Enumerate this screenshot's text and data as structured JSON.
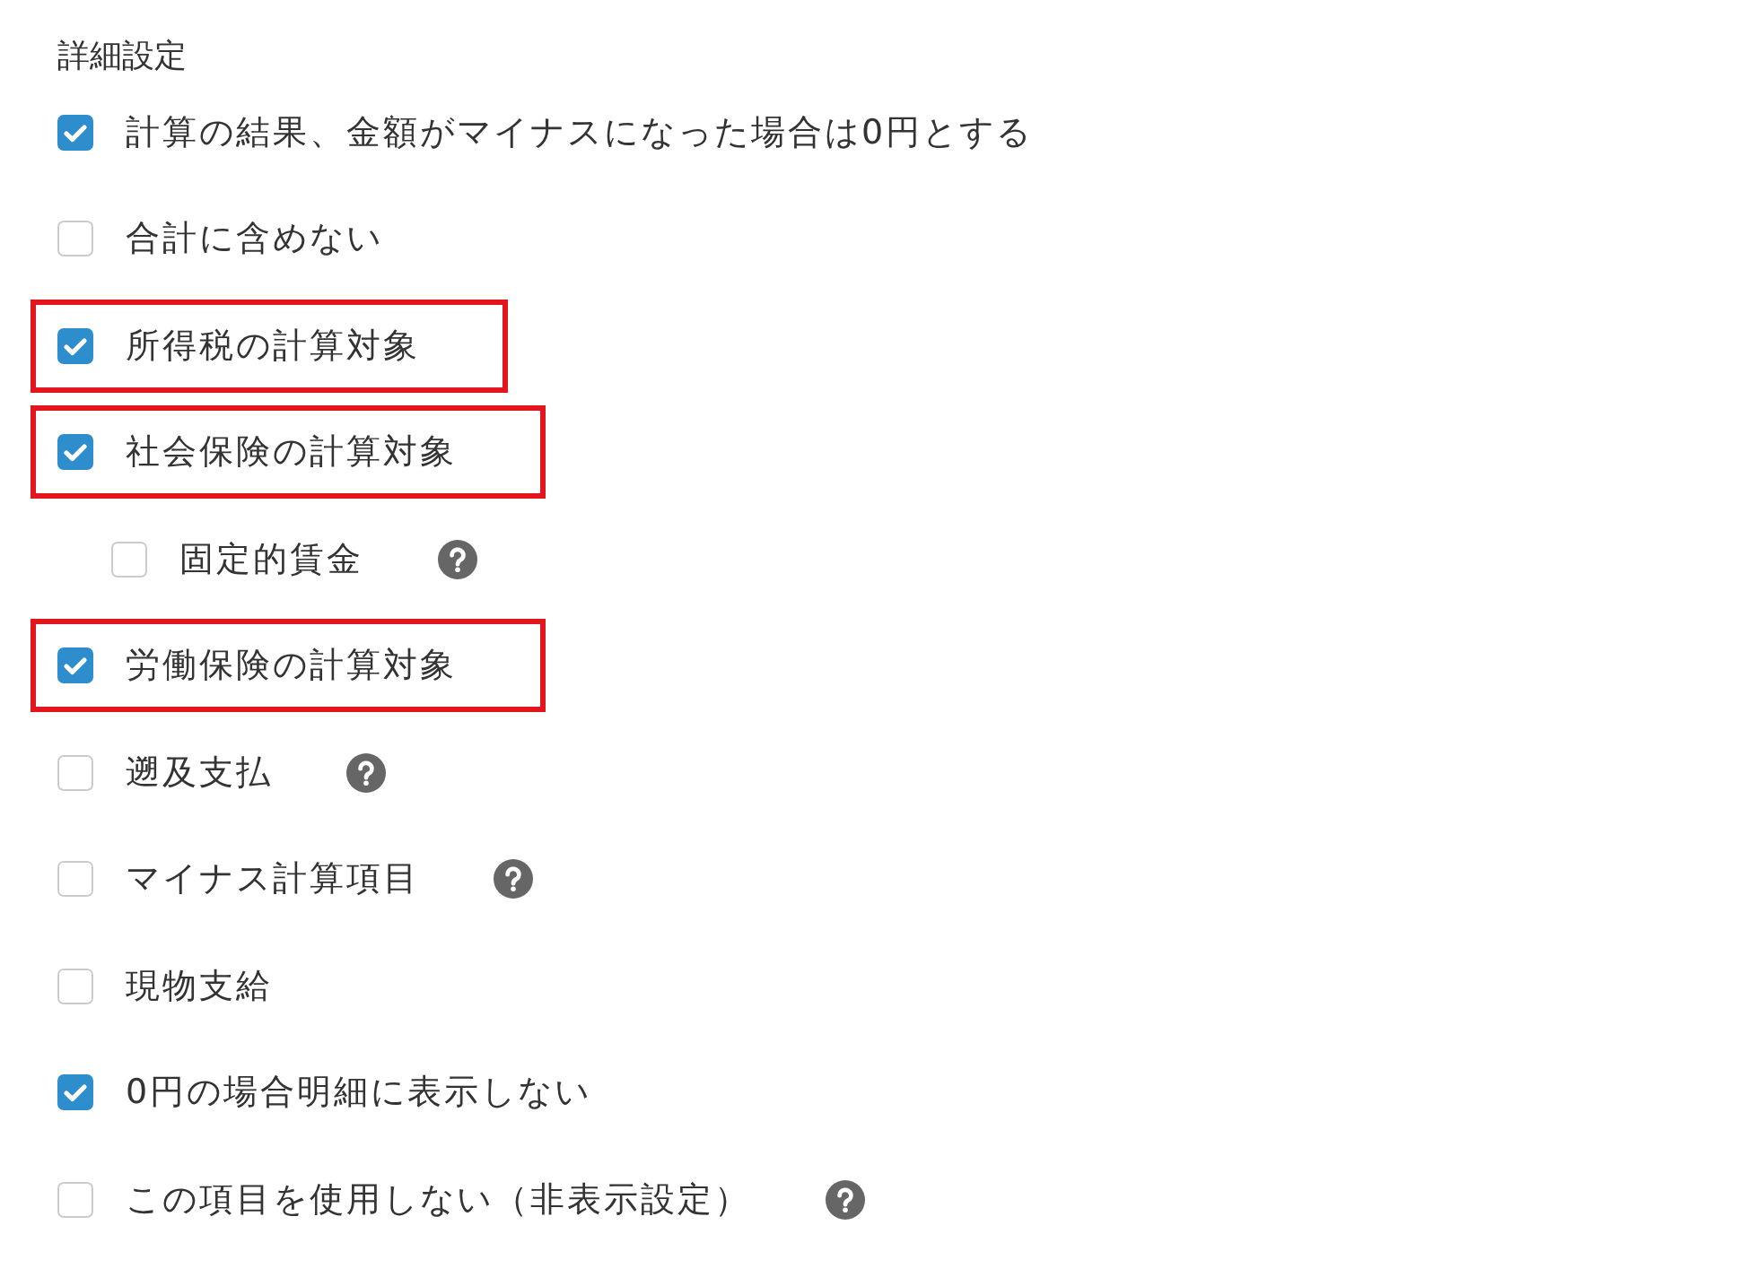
{
  "section_title": "詳細設定",
  "options": [
    {
      "label": "計算の結果、金額がマイナスになった場合は0円とする",
      "checked": true,
      "highlighted": false,
      "help": false
    },
    {
      "label": "合計に含めない",
      "checked": false,
      "highlighted": false,
      "help": false
    },
    {
      "label": "所得税の計算対象",
      "checked": true,
      "highlighted": true,
      "help": false
    },
    {
      "label": "社会保険の計算対象",
      "checked": true,
      "highlighted": true,
      "help": false,
      "children": [
        {
          "label": "固定的賃金",
          "checked": false,
          "highlighted": false,
          "help": true
        }
      ]
    },
    {
      "label": "労働保険の計算対象",
      "checked": true,
      "highlighted": true,
      "help": false
    },
    {
      "label": "遡及支払",
      "checked": false,
      "highlighted": false,
      "help": true
    },
    {
      "label": "マイナス計算項目",
      "checked": false,
      "highlighted": false,
      "help": true
    },
    {
      "label": "現物支給",
      "checked": false,
      "highlighted": false,
      "help": false
    },
    {
      "label": "0円の場合明細に表示しない",
      "checked": true,
      "highlighted": false,
      "help": false
    },
    {
      "label": "この項目を使用しない（非表示設定）",
      "checked": false,
      "highlighted": false,
      "help": true
    }
  ]
}
